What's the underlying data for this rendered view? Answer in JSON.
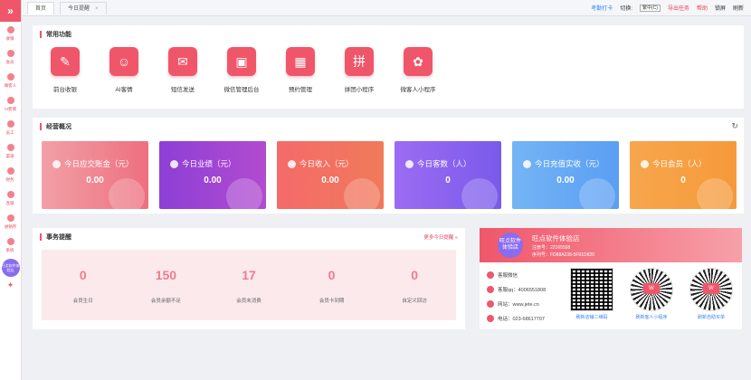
{
  "sidebar": {
    "toggle": "»",
    "items": [
      "收银",
      "会员",
      "微客人",
      "AI客情",
      "员工",
      "渠道",
      "财务",
      "连锁",
      "进销存",
      "系统"
    ],
    "store_badge": "旺点软件体验店"
  },
  "topbar": {
    "tabs": [
      {
        "label": "首页"
      },
      {
        "label": "今日提醒",
        "close": "×"
      }
    ],
    "right": {
      "kaoqin": "考勤打卡",
      "switch_label": "切换:",
      "switch_value": "繁中(C)",
      "export": "导出任务",
      "help": "帮助",
      "lock": "锁屏",
      "refresh": "刷新"
    }
  },
  "common": {
    "title": "常用功能",
    "items": [
      {
        "label": "前台收银",
        "icon": "cashier-icon",
        "glyph": "✎"
      },
      {
        "label": "AI客情",
        "icon": "ai-customer-icon",
        "glyph": "☺"
      },
      {
        "label": "短信发送",
        "icon": "sms-icon",
        "glyph": "✉"
      },
      {
        "label": "微信管理后台",
        "icon": "wechat-admin-icon",
        "glyph": "▣"
      },
      {
        "label": "预约管理",
        "icon": "booking-icon",
        "glyph": "▦"
      },
      {
        "label": "拼团小程序",
        "icon": "group-buy-icon",
        "glyph": "拼"
      },
      {
        "label": "微客人小程序",
        "icon": "miniapp-icon",
        "glyph": "✿"
      }
    ]
  },
  "business": {
    "title": "经营概况",
    "cards": [
      {
        "label": "今日应交账金（元）",
        "value": "0.00",
        "icon": "receivable-icon"
      },
      {
        "label": "今日业绩（元）",
        "value": "0.00",
        "icon": "performance-icon"
      },
      {
        "label": "今日收入（元）",
        "value": "0.00",
        "icon": "income-icon"
      },
      {
        "label": "今日客数（人）",
        "value": "0",
        "icon": "customers-icon"
      },
      {
        "label": "今日充值实收（元）",
        "value": "0.00",
        "icon": "recharge-icon"
      },
      {
        "label": "今日会员（人）",
        "value": "0",
        "icon": "members-icon"
      }
    ]
  },
  "tasks": {
    "title": "事务提醒",
    "more": "更多今日提醒 »",
    "items": [
      {
        "count": "0",
        "label": "会员生日"
      },
      {
        "count": "150",
        "label": "会员余额不足"
      },
      {
        "count": "17",
        "label": "会员未消费"
      },
      {
        "count": "0",
        "label": "会员卡到期"
      },
      {
        "count": "0",
        "label": "自定义回访"
      }
    ]
  },
  "store": {
    "logo_text": "旺点软件体验店",
    "name": "旺点软件体验店",
    "register_no": "注册号：22165598",
    "serial_no": "序列号：FD88A238-5F91D820",
    "contacts": [
      {
        "label": "客服微信",
        "icon": "wechat-icon"
      },
      {
        "label": "客服qq：4006551808",
        "icon": "qq-icon"
      },
      {
        "label": "网站：www.jete.cn",
        "icon": "website-icon"
      },
      {
        "label": "电话：023-68617707",
        "icon": "phone-icon"
      }
    ],
    "qrcodes": [
      {
        "caption": "刷新店铺二维码"
      },
      {
        "caption": "刷新客人小程序"
      },
      {
        "caption": "刷新自助买单"
      }
    ]
  }
}
